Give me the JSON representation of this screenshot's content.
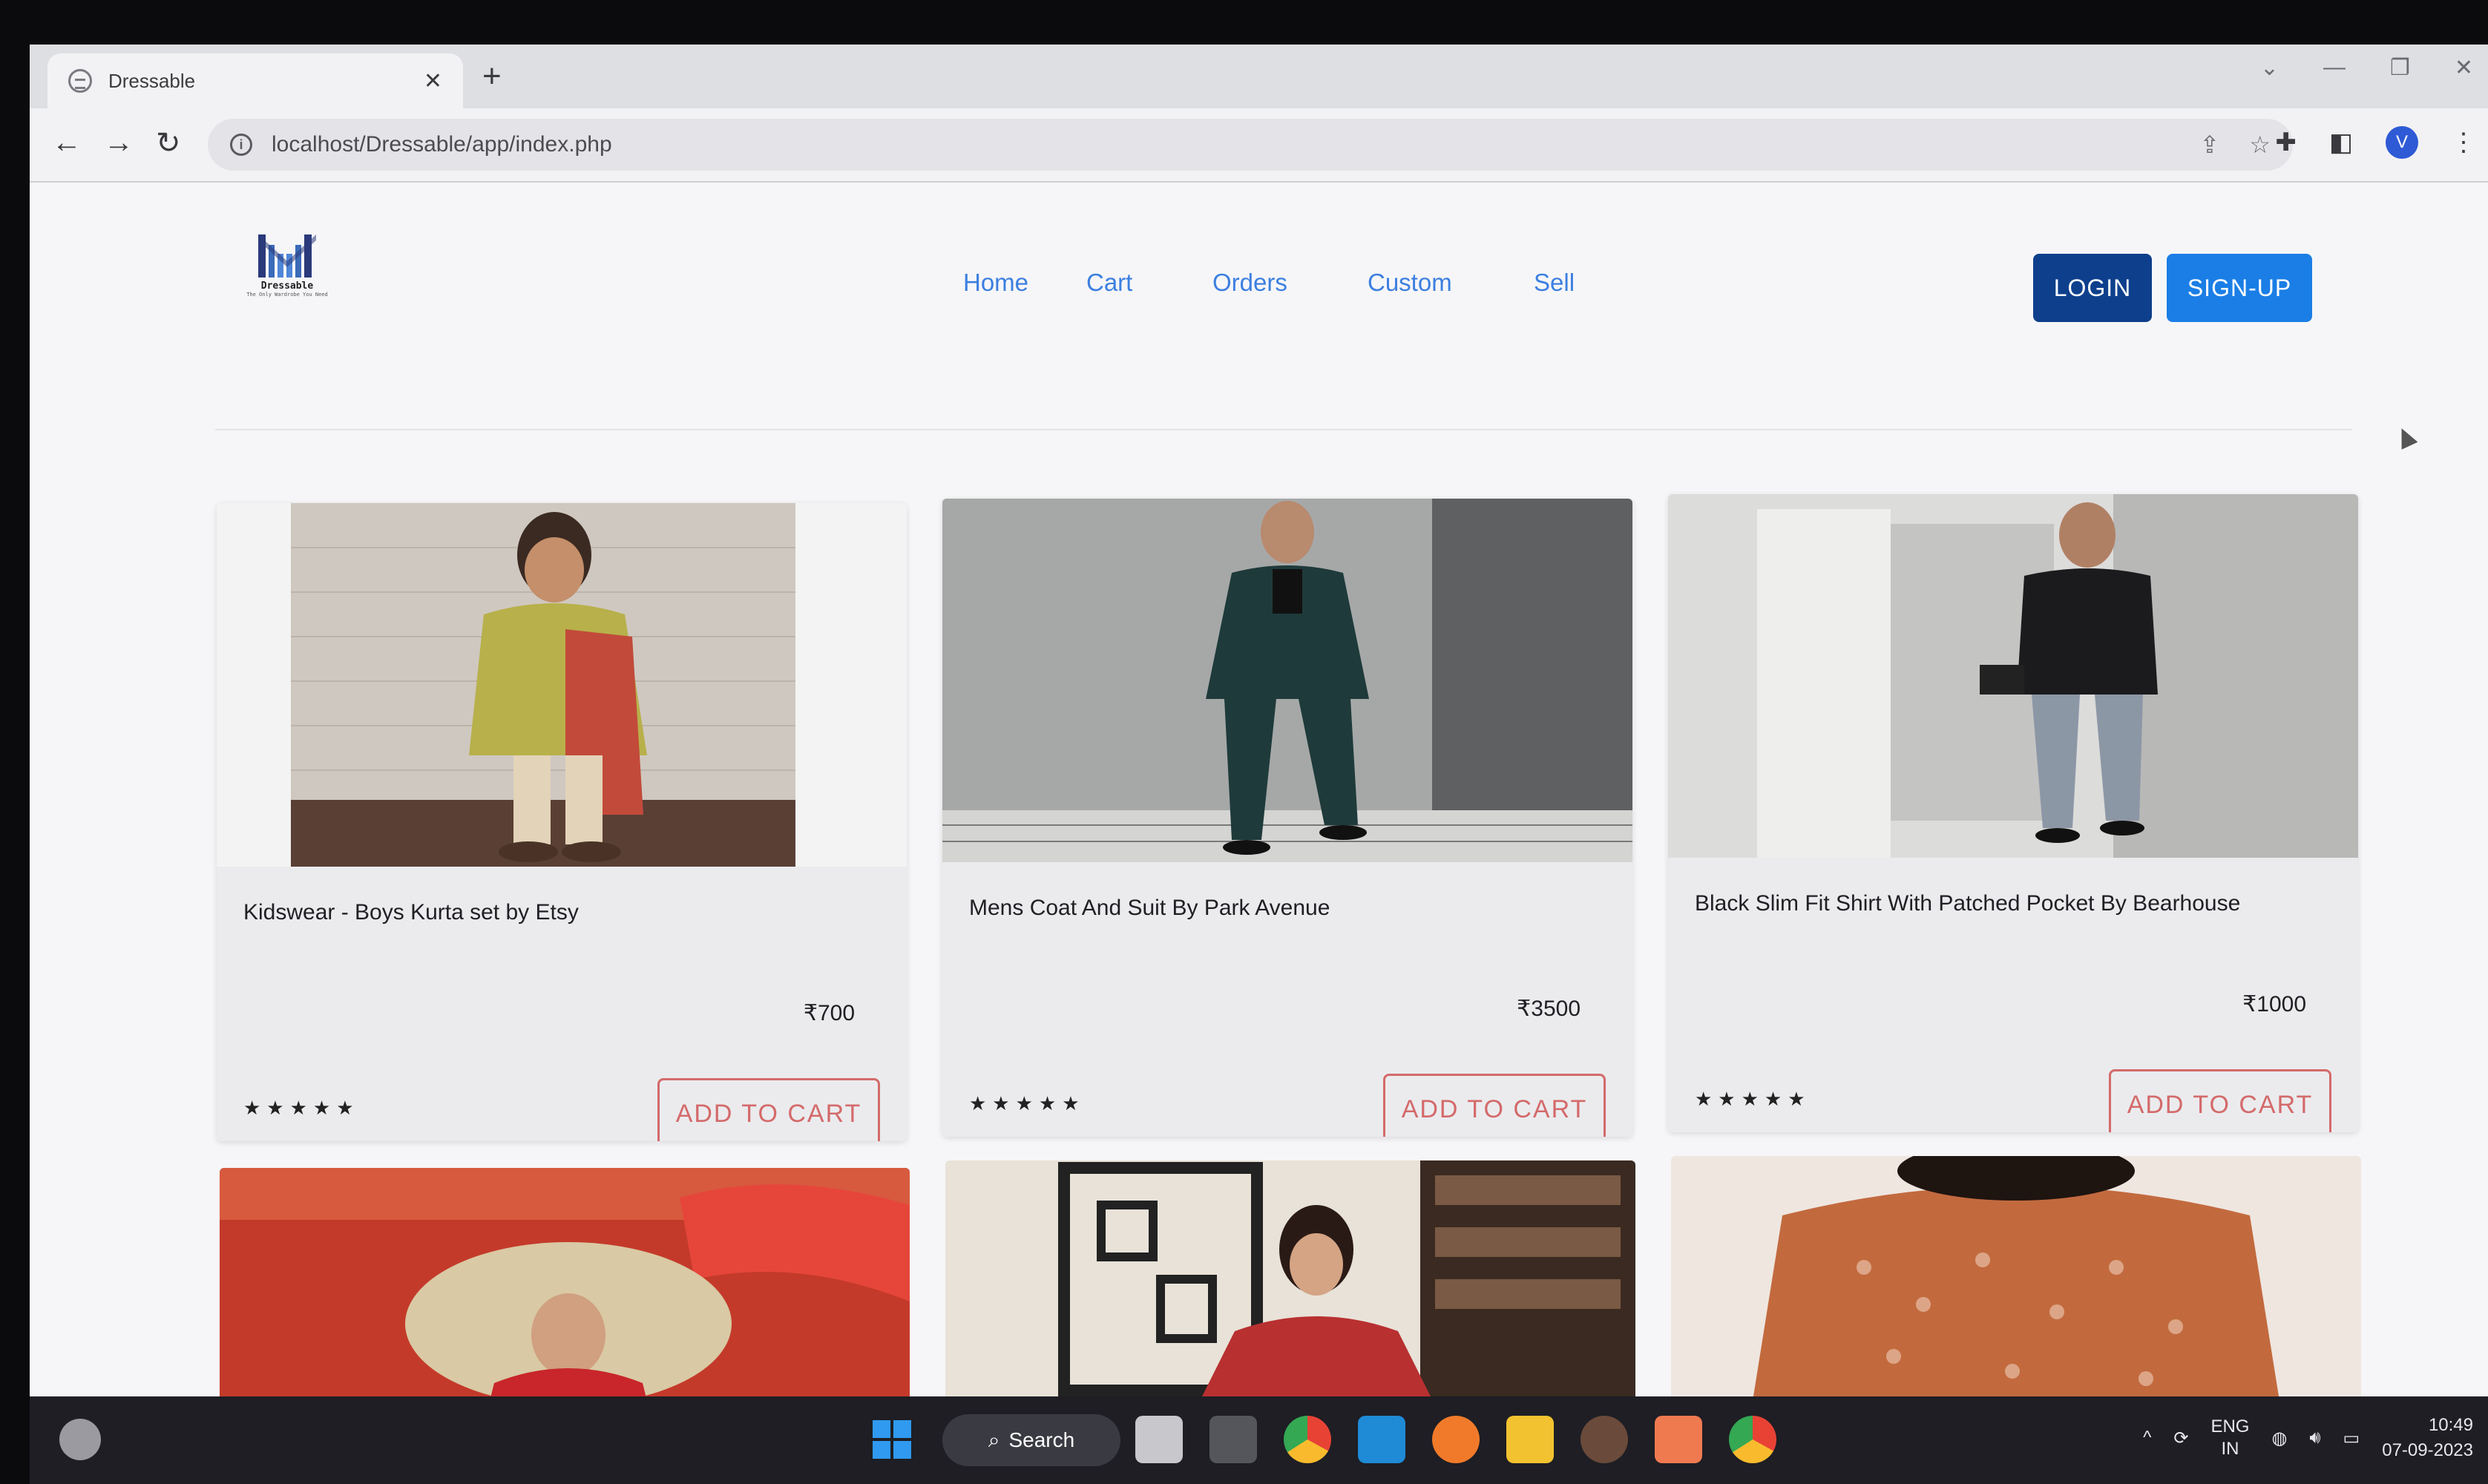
{
  "browser": {
    "tab_title": "Dressable",
    "tab_close": "✕",
    "new_tab": "+",
    "url": "localhost/Dressable/app/index.php",
    "back": "←",
    "forward": "→",
    "reload": "↻",
    "avatar_initial": "V"
  },
  "site": {
    "logo_text": "Dressable",
    "logo_tagline": "The Only Wardrobe You Need",
    "nav": [
      "Home",
      "Cart",
      "Orders",
      "Custom",
      "Sell"
    ],
    "login_label": "LOGIN",
    "signup_label": "SIGN-UP",
    "colors": {
      "login": "#0d3f8c",
      "signup": "#1a7ee6",
      "nav_link": "#3c7fe0",
      "cart_button": "#d46a6a"
    }
  },
  "products": [
    {
      "name": "Kidswear - Boys Kurta set by Etsy",
      "price": "₹700",
      "rating": "★★★★★",
      "button": "ADD TO CART"
    },
    {
      "name": "Mens Coat And Suit By Park Avenue",
      "price": "₹3500",
      "rating": "★★★★★",
      "button": "ADD TO CART"
    },
    {
      "name": "Black Slim Fit Shirt With Patched Pocket By Bearhouse",
      "price": "₹1000",
      "rating": "★★★★★",
      "button": "ADD TO CART"
    }
  ],
  "taskbar": {
    "search_label": "Search",
    "lang_line1": "ENG",
    "lang_line2": "IN",
    "time": "10:49",
    "date": "07-09-2023"
  }
}
